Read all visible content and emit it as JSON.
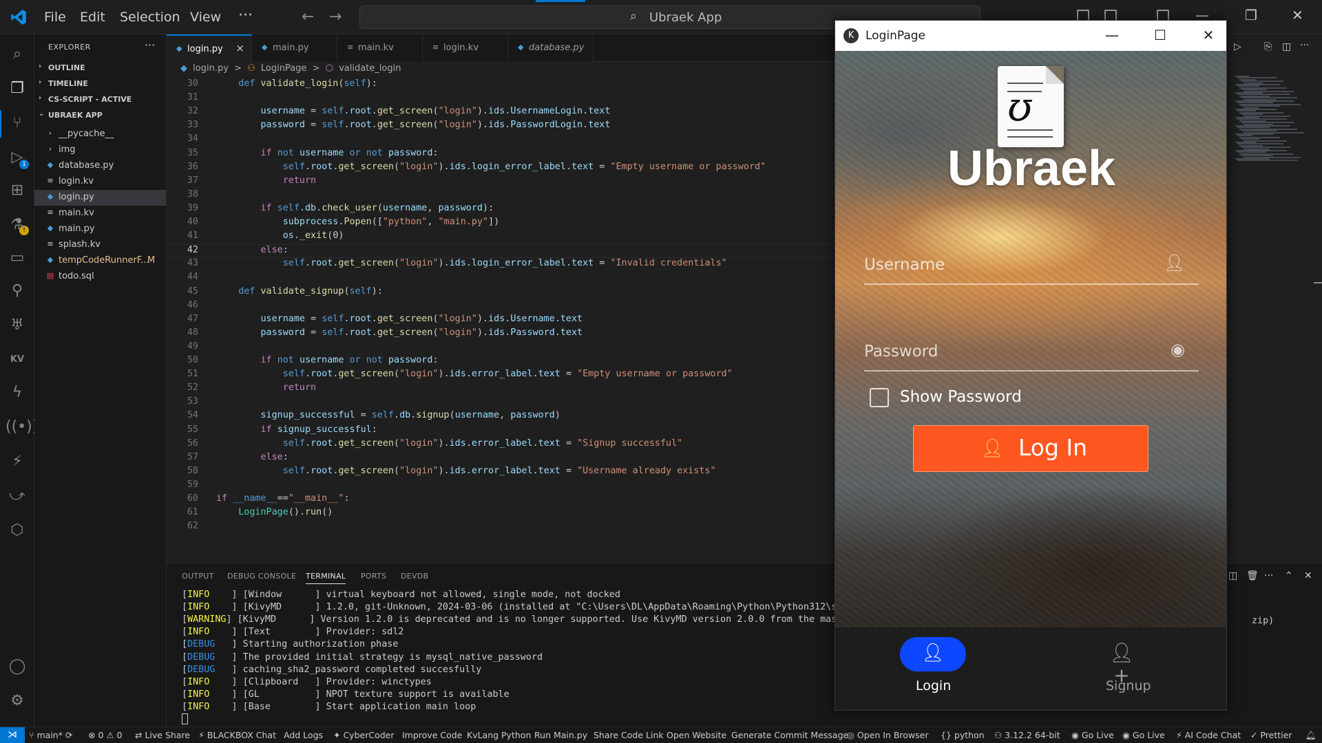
{
  "titlebar": {
    "menus": [
      "File",
      "Edit",
      "Selection",
      "View"
    ],
    "more": "···",
    "command_center": "Ubraek App"
  },
  "explorer": {
    "title": "EXPLORER",
    "more": "···",
    "sections": {
      "outline": "OUTLINE",
      "timeline": "TIMELINE",
      "cs_script": "CS-SCRIPT - ACTIVE",
      "project": "UBRAEK APP"
    },
    "files": [
      {
        "name": "__pycache__",
        "icon": "folder-chevron-icon",
        "type": "folder"
      },
      {
        "name": "img",
        "icon": "folder-chevron-icon",
        "type": "folder"
      },
      {
        "name": "database.py",
        "icon": "python-file-icon",
        "type": "file"
      },
      {
        "name": "login.kv",
        "icon": "text-file-icon",
        "type": "file"
      },
      {
        "name": "login.py",
        "icon": "python-file-icon",
        "type": "file",
        "selected": true
      },
      {
        "name": "main.kv",
        "icon": "text-file-icon",
        "type": "file"
      },
      {
        "name": "main.py",
        "icon": "python-file-icon",
        "type": "file"
      },
      {
        "name": "splash.kv",
        "icon": "text-file-icon",
        "type": "file"
      },
      {
        "name": "tempCodeRunnerF...",
        "icon": "python-file-icon",
        "type": "file",
        "mark": "M"
      },
      {
        "name": "todo.sql",
        "icon": "database-file-icon",
        "type": "file"
      }
    ]
  },
  "tabs": [
    {
      "name": "login.py",
      "active": true,
      "close": "×"
    },
    {
      "name": "main.py"
    },
    {
      "name": "main.kv"
    },
    {
      "name": "login.kv"
    },
    {
      "name": "database.py",
      "italic": true
    }
  ],
  "breadcrumb": [
    "login.py",
    ">",
    "LoginPage",
    ">",
    "validate_login"
  ],
  "code": {
    "current_line": "42",
    "lines": [
      {
        "n": "30",
        "t": "    def validate_login(self):"
      },
      {
        "n": "31",
        "t": ""
      },
      {
        "n": "32",
        "t": "        username = self.root.get_screen(\"login\").ids.UsernameLogin.text"
      },
      {
        "n": "33",
        "t": "        password = self.root.get_screen(\"login\").ids.PasswordLogin.text"
      },
      {
        "n": "34",
        "t": ""
      },
      {
        "n": "35",
        "t": "        if not username or not password:"
      },
      {
        "n": "36",
        "t": "            self.root.get_screen(\"login\").ids.login_error_label.text = \"Empty username or password\""
      },
      {
        "n": "37",
        "t": "            return"
      },
      {
        "n": "38",
        "t": ""
      },
      {
        "n": "39",
        "t": "        if self.db.check_user(username, password):"
      },
      {
        "n": "40",
        "t": "            subprocess.Popen([\"python\", \"main.py\"])"
      },
      {
        "n": "41",
        "t": "            os._exit(0)"
      },
      {
        "n": "42",
        "t": "        else:"
      },
      {
        "n": "43",
        "t": "            self.root.get_screen(\"login\").ids.login_error_label.text = \"Invalid credentials\""
      },
      {
        "n": "44",
        "t": ""
      },
      {
        "n": "45",
        "t": "    def validate_signup(self):"
      },
      {
        "n": "46",
        "t": ""
      },
      {
        "n": "47",
        "t": "        username = self.root.get_screen(\"login\").ids.Username.text"
      },
      {
        "n": "48",
        "t": "        password = self.root.get_screen(\"login\").ids.Password.text"
      },
      {
        "n": "49",
        "t": ""
      },
      {
        "n": "50",
        "t": "        if not username or not password:"
      },
      {
        "n": "51",
        "t": "            self.root.get_screen(\"login\").ids.error_label.text = \"Empty username or password\""
      },
      {
        "n": "52",
        "t": "            return"
      },
      {
        "n": "53",
        "t": ""
      },
      {
        "n": "54",
        "t": "        signup_successful = self.db.signup(username, password)"
      },
      {
        "n": "55",
        "t": "        if signup_successful:"
      },
      {
        "n": "56",
        "t": "            self.root.get_screen(\"login\").ids.error_label.text = \"Signup successful\""
      },
      {
        "n": "57",
        "t": "        else:"
      },
      {
        "n": "58",
        "t": "            self.root.get_screen(\"login\").ids.error_label.text = \"Username already exists\""
      },
      {
        "n": "59",
        "t": ""
      },
      {
        "n": "60",
        "t": "if __name__==\"__main__\":"
      },
      {
        "n": "61",
        "t": "    LoginPage().run()"
      },
      {
        "n": "62",
        "t": ""
      }
    ]
  },
  "panel": {
    "tabs": [
      "OUTPUT",
      "DEBUG CONSOLE",
      "TERMINAL",
      "PORTS",
      "DEVDB"
    ],
    "active_tab": "TERMINAL",
    "terminal": [
      {
        "level": "INFO   ",
        "kind": "info",
        "text": " ] [Window      ] virtual keyboard not allowed, single mode, not docked"
      },
      {
        "level": "INFO   ",
        "kind": "info",
        "text": " ] [KivyMD      ] 1.2.0, git-Unknown, 2024-03-06 (installed at \"C:\\Users\\DL\\AppData\\Roaming\\Python\\Python312\\sit"
      },
      {
        "level": "WARNING",
        "kind": "warn",
        "text": "] [KivyMD      ] Version 1.2.0 is deprecated and is no longer supported. Use KivyMD version 2.0.0 from the mast"
      },
      {
        "level": "INFO   ",
        "kind": "info",
        "text": " ] [Text        ] Provider: sdl2"
      },
      {
        "level": "DEBUG  ",
        "kind": "debug",
        "text": " ] Starting authorization phase"
      },
      {
        "level": "DEBUG  ",
        "kind": "debug",
        "text": " ] The provided initial strategy is mysql_native_password"
      },
      {
        "level": "DEBUG  ",
        "kind": "debug",
        "text": " ] caching_sha2_password completed succesfully"
      },
      {
        "level": "INFO   ",
        "kind": "info",
        "text": " ] [Clipboard   ] Provider: winctypes"
      },
      {
        "level": "INFO   ",
        "kind": "info",
        "text": " ] [GL          ] NPOT texture support is available"
      },
      {
        "level": "INFO   ",
        "kind": "info",
        "text": " ] [Base        ] Start application main loop"
      }
    ],
    "terminal_tail": "zip)"
  },
  "statusbar": {
    "branch": "main*",
    "problems": "⊗ 0 ⚠ 0",
    "items": [
      "Live Share",
      "BLACKBOX Chat",
      "Add Logs",
      "CyberCoder",
      "Improve Code",
      "KvLang Python",
      "Run Main.py",
      "Share Code Link",
      "Open Website",
      "Generate Commit Message",
      "Open In Browser",
      "{} python",
      "3.12.2 64-bit",
      "Go Live",
      "Go Live",
      "AI Code Chat",
      "Prettier"
    ]
  },
  "kivy_window": {
    "title": "LoginPage",
    "app_name": "Ubraek",
    "logo_glyph": "ʊ",
    "username_label": "Username",
    "password_label": "Password",
    "show_password_label": "Show Password",
    "show_password_checked": false,
    "login_button": "Log In",
    "nav": [
      {
        "label": "Login",
        "icon": "person-icon",
        "active": true
      },
      {
        "label": "Signup",
        "icon": "person-add-icon",
        "active": false
      }
    ],
    "colors": {
      "button": "#ff5722",
      "nav_active": "#0d47ff"
    }
  },
  "colors": {
    "accent": "#0078d4",
    "keyword": "#569cd6",
    "function": "#dcdcaa",
    "string": "#ce9178",
    "variable": "#9cdcfe",
    "class": "#4ec9b0",
    "control": "#c586c0"
  }
}
